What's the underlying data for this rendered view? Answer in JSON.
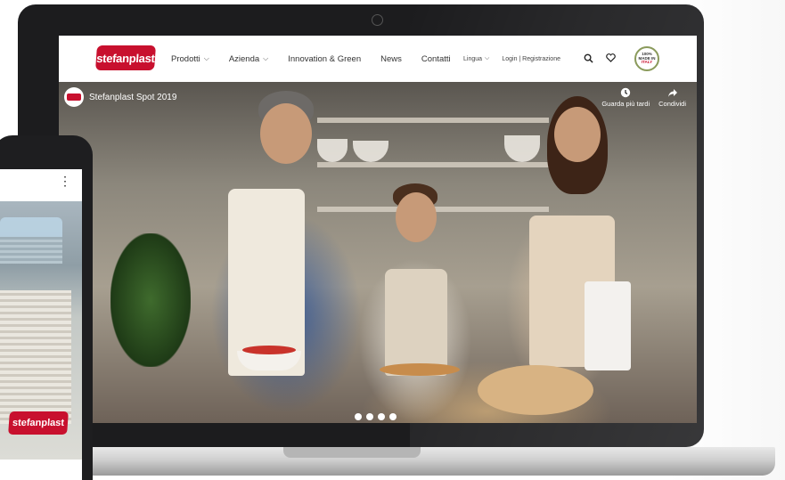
{
  "header": {
    "logo_text": "stefanplast",
    "nav": [
      {
        "label": "Prodotti",
        "has_dropdown": true
      },
      {
        "label": "Azienda",
        "has_dropdown": true
      },
      {
        "label": "Innovation & Green",
        "has_dropdown": false
      },
      {
        "label": "News",
        "has_dropdown": false
      },
      {
        "label": "Contatti",
        "has_dropdown": false
      }
    ],
    "language_label": "Lingua",
    "login_label": "Login | Registrazione",
    "badge": {
      "line1": "100%",
      "line2": "MADE IN",
      "line3": "ITALY"
    }
  },
  "video": {
    "title": "Stefanplast Spot 2019",
    "watch_later_label": "Guarda più tardi",
    "share_label": "Condividi",
    "slide_count": 4
  },
  "phone": {
    "logo_text": "stefanplast"
  },
  "colors": {
    "brand_red": "#c8102e",
    "device_dark": "#1c1c1e"
  },
  "icons": [
    "search-icon",
    "heart-icon",
    "chevron-down-icon",
    "clock-icon",
    "share-icon",
    "kebab-menu-icon"
  ]
}
